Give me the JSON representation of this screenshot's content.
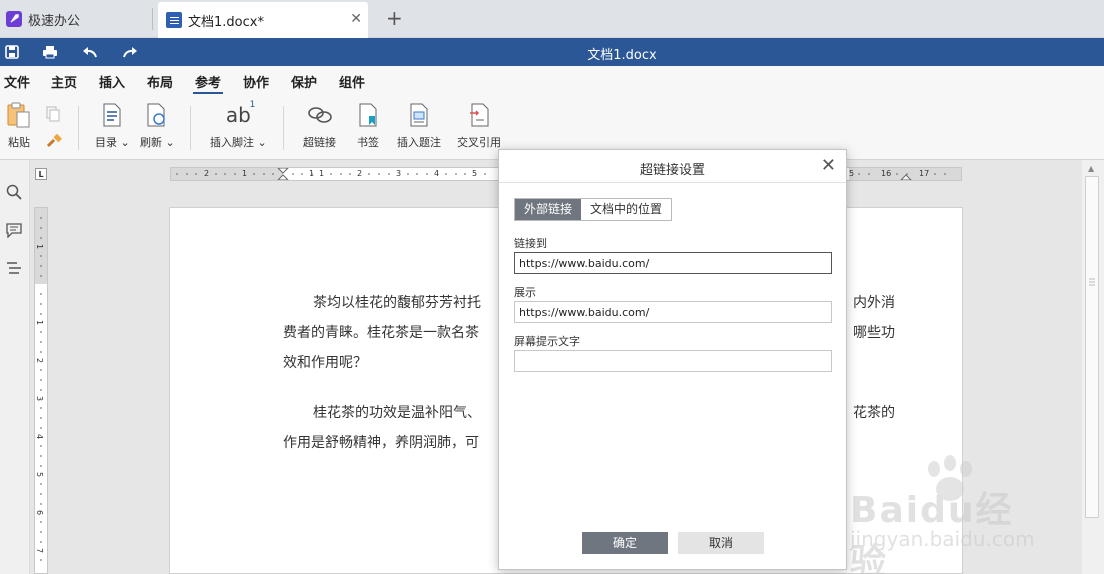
{
  "tabs": {
    "app_label": "极速办公",
    "doc_label": "文档1.docx*",
    "close_glyph": "✕",
    "new_glyph": "+"
  },
  "titlebar": {
    "title": "文档1.docx",
    "icons": [
      "save-icon",
      "print-icon",
      "undo-icon",
      "redo-icon"
    ]
  },
  "menu": {
    "items": [
      "文件",
      "主页",
      "插入",
      "布局",
      "参考",
      "协作",
      "保护",
      "组件"
    ],
    "active": "参考"
  },
  "toolbar": {
    "paste": "粘贴",
    "toc": "目录",
    "refresh": "刷新",
    "footnote": "插入脚注",
    "hyperlink": "超链接",
    "bookmark": "书签",
    "caption": "插入题注",
    "crossref": "交叉引用",
    "footnote_glyph": "ab",
    "footnote_sup": "1"
  },
  "ruler": {
    "corner": "L",
    "h_left": [
      "2",
      "1",
      "1"
    ],
    "h_right": [
      "1",
      "2",
      "3",
      "4",
      "5"
    ],
    "h_far": [
      "5",
      "16",
      "17"
    ],
    "v": [
      "1",
      "1",
      "2",
      "3",
      "4",
      "5",
      "6",
      "7"
    ]
  },
  "document": {
    "para1_line1": "茶均以桂花的馥郁芬芳衬托",
    "para1_line1_tail": "内外消",
    "para1_line2": "费者的青睐。桂花茶是一款名茶",
    "para1_line2_tail": "哪些功",
    "para1_line3": "效和作用呢？",
    "para2_line1": "桂花茶的功效是温补阳气、",
    "para2_line1_tail": "花茶的",
    "para2_line2": "作用是舒畅精神，养阴润肺，可"
  },
  "dialog": {
    "title": "超链接设置",
    "close_glyph": "✕",
    "tab_external": "外部链接",
    "tab_internal": "文档中的位置",
    "link_label": "链接到",
    "link_value": "https://www.baidu.com/",
    "display_label": "展示",
    "display_value": "https://www.baidu.com/",
    "tooltip_label": "屏幕提示文字",
    "tooltip_value": "",
    "ok": "确定",
    "cancel": "取消"
  },
  "watermark": {
    "brand": "Baidu经验",
    "url": "jingyan.baidu.com"
  }
}
